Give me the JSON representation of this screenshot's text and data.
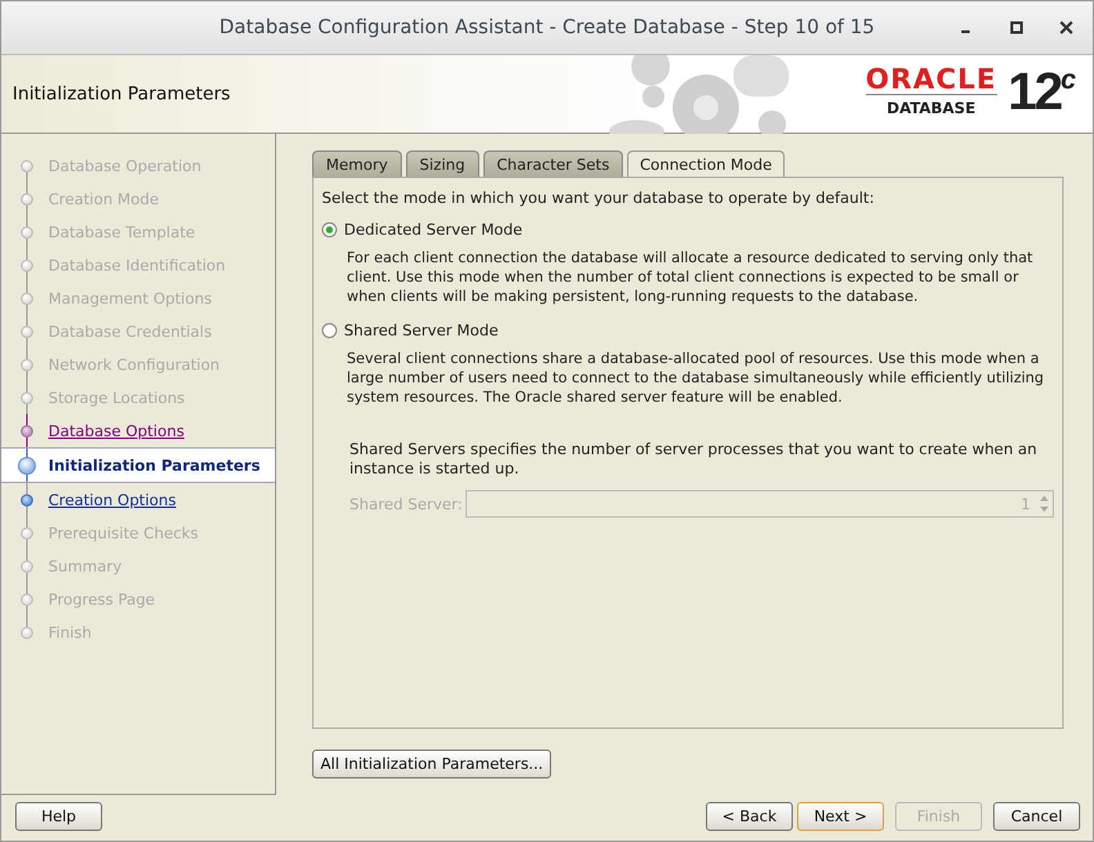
{
  "window": {
    "title": "Database Configuration Assistant - Create Database - Step 10 of 15"
  },
  "header": {
    "title": "Initialization Parameters",
    "logo": {
      "brand": "ORACLE",
      "product": "DATABASE",
      "version": "12$^{c}$"
    }
  },
  "steps": [
    {
      "label": "Database Operation",
      "kind": "pending"
    },
    {
      "label": "Creation Mode",
      "kind": "pending"
    },
    {
      "label": "Database Template",
      "kind": "pending"
    },
    {
      "label": "Database Identification",
      "kind": "pending"
    },
    {
      "label": "Management Options",
      "kind": "pending"
    },
    {
      "label": "Database Credentials",
      "kind": "pending"
    },
    {
      "label": "Network Configuration",
      "kind": "pending"
    },
    {
      "label": "Storage Locations",
      "kind": "pending"
    },
    {
      "label": "Database Options",
      "kind": "visited"
    },
    {
      "label": "Initialization Parameters",
      "kind": "current"
    },
    {
      "label": "Creation Options",
      "kind": "next"
    },
    {
      "label": "Prerequisite Checks",
      "kind": "pending"
    },
    {
      "label": "Summary",
      "kind": "pending"
    },
    {
      "label": "Progress Page",
      "kind": "pending"
    },
    {
      "label": "Finish",
      "kind": "pending"
    }
  ],
  "tabs": [
    {
      "label": "Memory",
      "selected": false
    },
    {
      "label": "Sizing",
      "selected": false
    },
    {
      "label": "Character Sets",
      "selected": false
    },
    {
      "label": "Connection Mode",
      "selected": true
    }
  ],
  "prompt": "Select the mode in which you want your database to operate by default:",
  "modes": [
    {
      "label": "Dedicated Server Mode",
      "selected": true,
      "description": "For each client connection the database will allocate a resource dedicated to serving only that client.  Use this mode when the number of total client connections is expected to be small or when clients will be making persistent, long-running requests to the database."
    },
    {
      "label": "Shared Server Mode",
      "selected": false,
      "description": "Several client connections share a database-allocated pool of resources.  Use this mode when a large number of users need to connect to the database simultaneously while efficiently utilizing system resources.  The Oracle shared server feature will be enabled."
    }
  ],
  "shared_servers": {
    "note": "Shared Servers specifies the number of server processes that you want to create when an instance is started up.",
    "label": "Shared Server:",
    "value": "1",
    "disabled": true
  },
  "all_params_button": "All Initialization Parameters...",
  "buttons": [
    {
      "label": "Help",
      "kind": "help",
      "disabled": false
    },
    {
      "label": "< Back",
      "kind": "nav",
      "disabled": false
    },
    {
      "label": "Next >",
      "kind": "default",
      "disabled": false
    },
    {
      "label": "Finish",
      "kind": "nav",
      "disabled": true
    },
    {
      "label": "Cancel",
      "kind": "nav",
      "disabled": false
    }
  ]
}
